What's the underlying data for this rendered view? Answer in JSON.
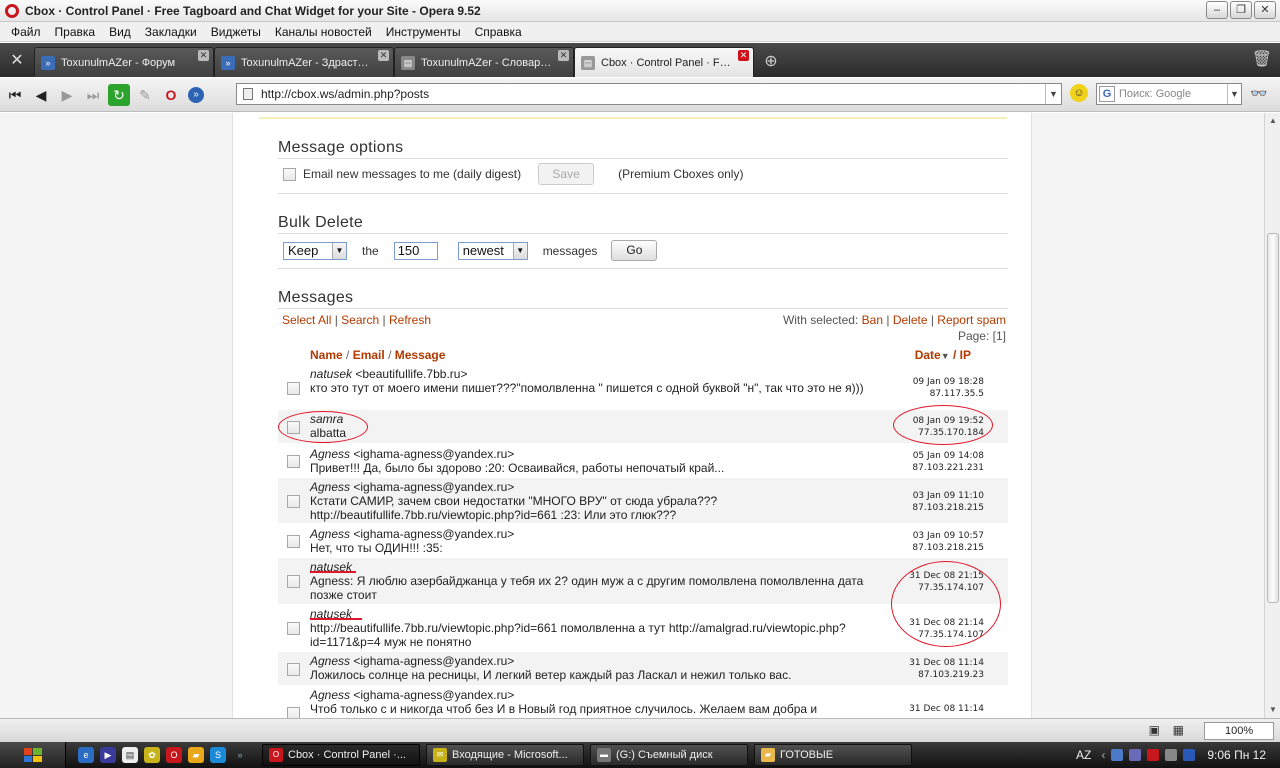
{
  "window": {
    "title": "Cbox · Control Panel · Free Tagboard and Chat Widget for your Site - Opera 9.52"
  },
  "menu": [
    "Файл",
    "Правка",
    "Вид",
    "Закладки",
    "Виджеты",
    "Каналы новостей",
    "Инструменты",
    "Справка"
  ],
  "tabs": [
    {
      "label": "ToxunulmAZer - Форум"
    },
    {
      "label": "ToxunulmAZer - Здраст…"
    },
    {
      "label": "ToxunulmAZer - Словар…"
    },
    {
      "label": "Cbox · Control Panel · F…"
    }
  ],
  "address": {
    "url": "http://cbox.ws/admin.php?posts",
    "search_placeholder": "Поиск: Google"
  },
  "options": {
    "title": "Message options",
    "email_label": "Email new messages to me (daily digest)",
    "save_label": "Save",
    "premium_note": "(Premium Cboxes only)"
  },
  "bulk": {
    "title": "Bulk Delete",
    "mode": "Keep",
    "the_label": "the",
    "count": "150",
    "order": "newest",
    "messages_label": "messages",
    "go_label": "Go"
  },
  "messages": {
    "title": "Messages",
    "links": {
      "select_all": "Select All",
      "search": "Search",
      "refresh": "Refresh"
    },
    "with_selected": "With selected:",
    "actions": {
      "ban": "Ban",
      "delete": "Delete",
      "report": "Report spam"
    },
    "page_label": "Page: [1]",
    "headers": {
      "name": "Name",
      "email": "Email",
      "message": "Message",
      "date": "Date",
      "ip": "IP"
    },
    "rows": [
      {
        "name": "natusek",
        "email": " <beautifullife.7bb.ru>",
        "text": "кто это тут от моего имени пишет???\"помолвленна \" пишется с одной буквой \"н\", так что это не я)))",
        "date": "09 Jan 09 18:28",
        "ip": "87.117.35.5"
      },
      {
        "name": "samra",
        "email": "",
        "text": "albatta",
        "date": "08 Jan 09 19:52",
        "ip": "77.35.170.184"
      },
      {
        "name": "Agness",
        "email": " <ighama-agness@yandex.ru>",
        "text": "Привет!!! Да, было бы здорово :20: Осваивайся, работы непочатый край...",
        "date": "05 Jan 09 14:08",
        "ip": "87.103.221.231"
      },
      {
        "name": "Agness",
        "email": " <ighama-agness@yandex.ru>",
        "text": "Кстати САМИР, зачем свои недостатки \"МНОГО ВРУ\" от сюда убрала??? http://beautifullife.7bb.ru/viewtopic.php?id=661 :23: Или это глюк???",
        "date": "03 Jan 09 11:10",
        "ip": "87.103.218.215"
      },
      {
        "name": "Agness",
        "email": " <ighama-agness@yandex.ru>",
        "text": "Нет, что ты ОДИН!!! :35:",
        "date": "03 Jan 09 10:57",
        "ip": "87.103.218.215"
      },
      {
        "name": "natusek",
        "email": "",
        "text": "Agness: Я люблю азербайджанца у тебя их 2? один муж а с другим помолвлена помолвленна дата позже стоит",
        "date": "31 Dec 08 21:15",
        "ip": "77.35.174.107"
      },
      {
        "name": "natusek",
        "email": "",
        "text": "http://beautifullife.7bb.ru/viewtopic.php?id=661 помолвленна а тут http://amalgrad.ru/viewtopic.php?id=1171&p=4 муж не понятно",
        "date": "31 Dec 08 21:14",
        "ip": "77.35.174.107"
      },
      {
        "name": "Agness",
        "email": " <ighama-agness@yandex.ru>",
        "text": "Ложилось солнце на ресницы, И легкий ветер каждый раз Ласкал и нежил только вас.",
        "date": "31 Dec 08 11:14",
        "ip": "87.103.219.23"
      },
      {
        "name": "Agness",
        "email": " <ighama-agness@yandex.ru>",
        "text": "Чтоб только с и никогда чтоб без И в Новый год приятное случилось. Желаем вам добра и",
        "date": "31 Dec 08 11:14",
        "ip": ""
      }
    ]
  },
  "statusbar": {
    "zoom": "100%"
  },
  "taskbar": {
    "tasks": [
      {
        "label": "Cbox · Control Panel ·..."
      },
      {
        "label": "Входящие - Microsoft..."
      },
      {
        "label": "(G:) Съемный диск"
      },
      {
        "label": "ГОТОВЫЕ"
      }
    ],
    "lang": "AZ",
    "clock": "9:06 Пн 12"
  },
  "colors": {
    "accent": "#b23a00",
    "annotation": "#e0162a",
    "taskbar": "#1c1c1c"
  }
}
